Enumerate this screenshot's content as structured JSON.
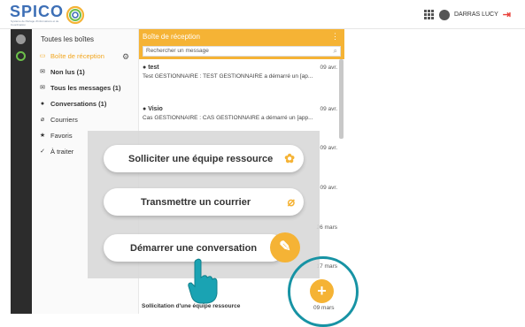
{
  "app": {
    "logo_text": "SPICO",
    "logo_subtitle": "Système de Partage d'Informations et de Coordination"
  },
  "topbar": {
    "user_name": "DARRAS LUCY"
  },
  "folders": {
    "title": "Toutes les boîtes",
    "items": [
      {
        "label": "Boîte de réception",
        "icon": "inbox-icon",
        "active": true,
        "bold": false
      },
      {
        "label": "Non lus (1)",
        "icon": "envelope-icon",
        "active": false,
        "bold": true
      },
      {
        "label": "Tous les messages (1)",
        "icon": "envelope-icon",
        "active": false,
        "bold": true
      },
      {
        "label": "Conversations (1)",
        "icon": "people-icon",
        "active": false,
        "bold": true
      },
      {
        "label": "Courriers",
        "icon": "paperclip-icon",
        "active": false,
        "bold": false
      },
      {
        "label": "Favoris",
        "icon": "star-icon",
        "active": false,
        "bold": false
      },
      {
        "label": "À traiter",
        "icon": "check-icon",
        "active": false,
        "bold": false
      }
    ]
  },
  "inbox": {
    "header": "Boîte de réception",
    "search_placeholder": "Rechercher un message",
    "messages": [
      {
        "from": "test",
        "date": "09 avr.",
        "preview": "Test GESTIONNAIRE : TEST GESTIONNAIRE a démarré un [ap..."
      },
      {
        "from": "Visio",
        "date": "09 avr.",
        "preview": "Cas GESTIONNAIRE : CAS GESTIONNAIRE a démarré un [app..."
      }
    ],
    "partial_dates": [
      "09 avr.",
      "09 avr.",
      "26 mars",
      "17 mars"
    ],
    "bottom_message": "Sollicitation d'une équipe ressource",
    "bottom_date": "09 mars"
  },
  "actions": {
    "solliciter": "Solliciter une équipe ressource",
    "transmettre": "Transmettre un courrier",
    "demarrer": "Démarrer une conversation"
  },
  "colors": {
    "accent": "#f5b335",
    "ring": "#1793a4",
    "logout": "#e8413a",
    "rail": "#2c2c2c"
  }
}
